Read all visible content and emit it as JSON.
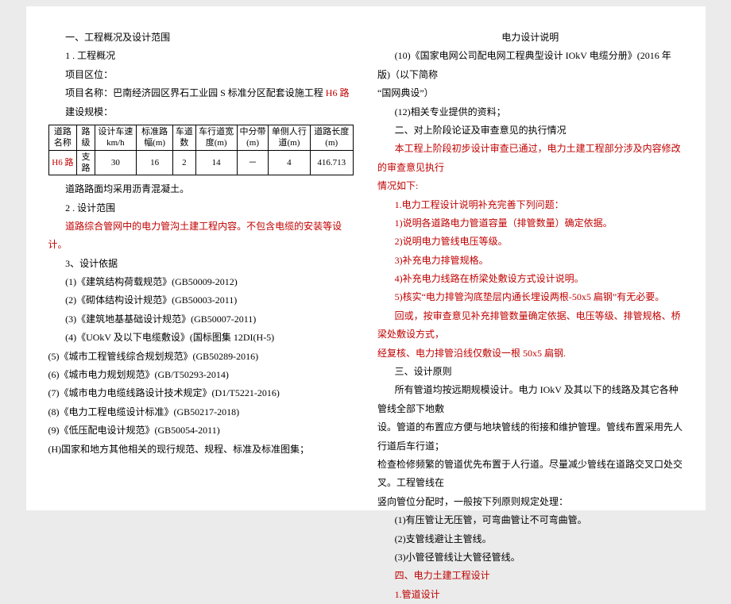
{
  "title_main": "电力设计说明",
  "left": {
    "h1": "一、工程概况及设计范围",
    "h1_1": "1 . 工程概况",
    "loc_label": "项目区位：",
    "name_label": "项目名称：",
    "name_value": "巴南经济园区界石工业园 S 标准分区配套设施工程 ",
    "name_red": "H6 路",
    "scale_label": "建设规模：",
    "table": {
      "headers": [
        "道路名称",
        "路级",
        "设计车速km/h",
        "标准路幅(m)",
        "车道数",
        "车行道宽度(m)",
        "中分带(m)",
        "单侧人行道(m)",
        "道路长度(m)"
      ],
      "row": [
        "H6 路",
        "支路",
        "30",
        "16",
        "2",
        "14",
        "－",
        "4",
        "416.713"
      ]
    },
    "surface": "道路路面均采用沥青混凝土。",
    "h1_2": "2 . 设计范围",
    "scope_red": "道路综合管网中的电力管沟土建工程内容。不包含电缆的安装等设计。",
    "h1_3": "3、设计依据",
    "refs": [
      "(1)《建筑结构荷载规范》(GB50009-2012)",
      "(2)《砌体结构设计规范》(GB50003-2011)",
      "(3)《建筑地基基础设计规范》(GB50007-2011)",
      "(4)《UOkV 及以下电缆敷设》(国标图集 12DI(H-5)",
      "(5)《城市工程管线综合规划规范》(GB50289-2016)",
      "(6)《城市电力规划规范》(GB/T50293-2014)",
      "(7)《城市电力电缆线路设计技术规定》(D1/T5221-2016)",
      "(8)《电力工程电缆设计标准》(GB50217-2018)",
      "(9)《低压配电设计规范》(GB50054-2011)",
      "(H)国家和地方其他相关的现行规范、规程、标准及标准图集；"
    ]
  },
  "right": {
    "r10a": "(10)《国家电网公司配电网工程典型设计 IOkV 电缆分册》(2016 年版)（以下简称",
    "r10b": "“国网典设”）",
    "r12": "(12)相关专业提供的资料；",
    "h2": "二、对上阶段论证及审查意见的执行情况",
    "p_red1": "本工程上阶段初步设计审查已通过，电力土建工程部分涉及内容修改的审查意见执行",
    "p_red2": "情况如下:",
    "items_red": [
      "1.电力工程设计说明补充完善下列问题：",
      "1)说明各道路电力管道容量（排管数量）确定依据。",
      "2)说明电力管线电压等级。",
      "3)补充电力排管规格。",
      "4)补充电力线路在桥梁处敷设方式设计说明。",
      "5)核实“电力排管沟底垫层内通长埋设两根-50x5 扁钢”有无必要。"
    ],
    "reply1": "回或，按审查意见补充排管数量确定依据、电压等级、排管规格、桥梁处敷设方式，",
    "reply2": "经复核、电力排管沿线仅敷设一根 50x5 扁钢.",
    "h3": "三、设计原则",
    "dp1": "所有管道均按远期规模设计。电力 IOkV 及其以下的线路及其它各种管线全部下地敷",
    "dp2": "设。管道的布置应方便与地块管线的衔接和维护管理。管线布置采用先人行道后车行道；",
    "dp3": "检查检修频繁的管道优先布置于人行道。尽量减少管线在道路交叉口处交叉。工程管线在",
    "dp4": "竖向管位分配时，一般按下列原则规定处理：",
    "dp_list": [
      "(1)有压管让无压管，可弯曲管让不可弯曲管。",
      "(2)支管线避让主管线。",
      "(3)小管径管线让大管径管线。"
    ],
    "h4_red_a": "四、电力土建工程设计",
    "h4_red_b": "1.管道设计"
  }
}
